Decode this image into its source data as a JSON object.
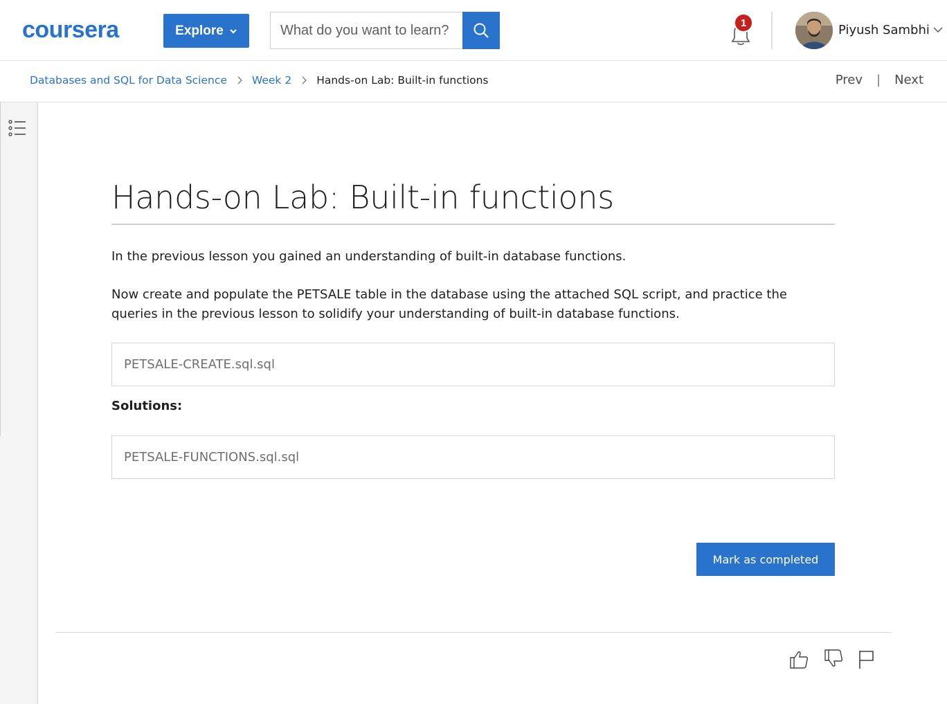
{
  "header": {
    "logo_text": "coursera",
    "explore_label": "Explore",
    "search": {
      "placeholder": "What do you want to learn?"
    },
    "notification_count": "1",
    "user_name": "Piyush Sambhi"
  },
  "breadcrumb": {
    "items": [
      "Databases and SQL for Data Science",
      "Week 2"
    ],
    "current": "Hands-on Lab: Built-in functions"
  },
  "nav": {
    "prev_label": "Prev",
    "divider": "|",
    "next_label": "Next"
  },
  "content": {
    "title": "Hands-on Lab: Built-in functions",
    "paragraph1": "In the previous lesson you gained an understanding of built-in database functions.",
    "paragraph2": "Now create and populate the PETSALE table in the database using the attached SQL script, and practice the queries in the previous lesson to solidify your understanding of built-in database functions.",
    "file1": "PETSALE-CREATE.sql.sql",
    "solutions_label": "Solutions:",
    "file2": "PETSALE-FUNCTIONS.sql.sql",
    "complete_label": "Mark as completed"
  },
  "colors": {
    "accent": "#2a73cc",
    "badge": "#c3201e"
  },
  "icons": [
    "search-icon",
    "bell-icon",
    "chevron-down-icon",
    "chevron-right-icon",
    "list-menu-icon",
    "thumbs-up-icon",
    "thumbs-down-icon",
    "flag-icon"
  ]
}
